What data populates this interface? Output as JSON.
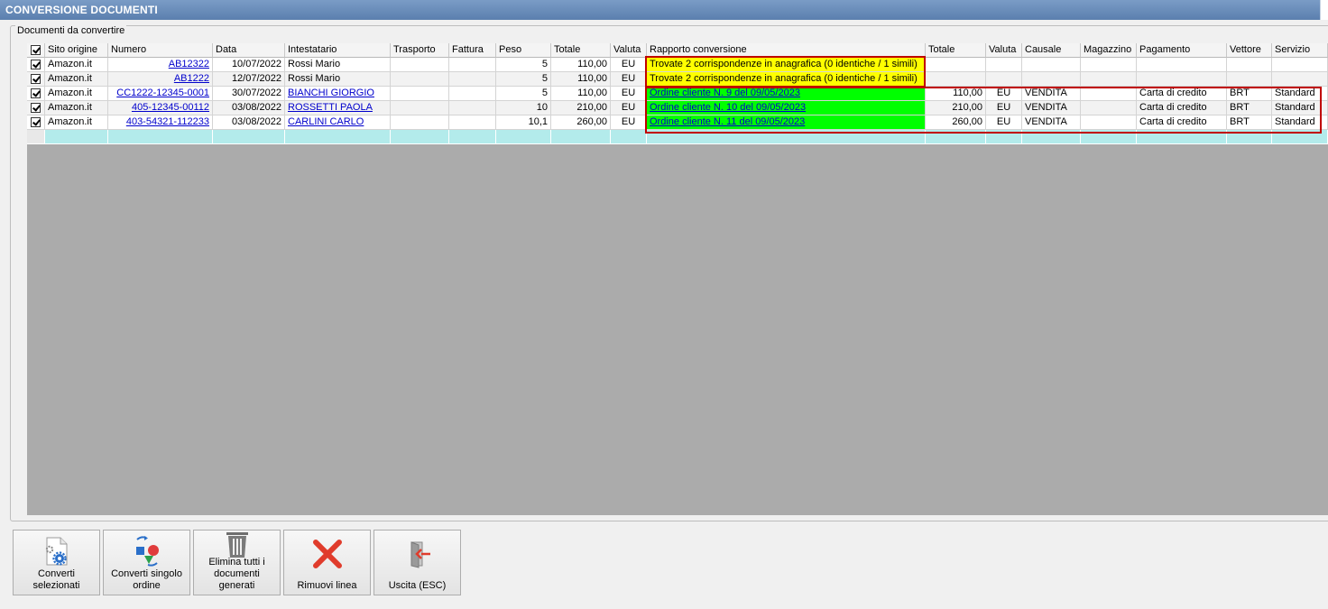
{
  "window": {
    "title": "CONVERSIONE DOCUMENTI"
  },
  "group": {
    "label": "Documenti da convertire"
  },
  "columns": [
    "",
    "Sito origine",
    "Numero",
    "Data",
    "Intestatario",
    "Trasporto",
    "Fattura",
    "Peso",
    "Totale",
    "Valuta",
    "Rapporto conversione",
    "Totale",
    "Valuta",
    "Causale",
    "Magazzino",
    "Pagamento",
    "Vettore",
    "Servizio"
  ],
  "rows": [
    {
      "checked": true,
      "sito": "Amazon.it",
      "numero": "AB12322",
      "data": "10/07/2022",
      "intestatario": "Rossi Mario",
      "trasporto": "",
      "fattura": "",
      "peso": "5",
      "totale": "110,00",
      "valuta": "EU",
      "rapporto": "Trovate 2 corrispondenze in anagrafica (0 identiche / 1 simili)",
      "totale2": "",
      "valuta2": "",
      "causale": "",
      "magazzino": "",
      "pagamento": "",
      "vettore": "",
      "servizio": ""
    },
    {
      "checked": true,
      "sito": "Amazon.it",
      "numero": "AB1222",
      "data": "12/07/2022",
      "intestatario": "Rossi Mario",
      "trasporto": "",
      "fattura": "",
      "peso": "5",
      "totale": "110,00",
      "valuta": "EU",
      "rapporto": "Trovate 2 corrispondenze in anagrafica (0 identiche / 1 simili)",
      "totale2": "",
      "valuta2": "",
      "causale": "",
      "magazzino": "",
      "pagamento": "",
      "vettore": "",
      "servizio": ""
    },
    {
      "checked": true,
      "sito": "Amazon.it",
      "numero": "CC1222-12345-0001",
      "data": "30/07/2022",
      "intestatario": "BIANCHI GIORGIO",
      "trasporto": "",
      "fattura": "",
      "peso": "5",
      "totale": "110,00",
      "valuta": "EU",
      "rapporto": "Ordine cliente N. 9 del 09/05/2023",
      "totale2": "110,00",
      "valuta2": "EU",
      "causale": "VENDITA",
      "magazzino": "",
      "pagamento": "Carta di credito",
      "vettore": "BRT",
      "servizio": "Standard"
    },
    {
      "checked": true,
      "sito": "Amazon.it",
      "numero": "405-12345-00112",
      "data": "03/08/2022",
      "intestatario": "ROSSETTI PAOLA",
      "trasporto": "",
      "fattura": "",
      "peso": "10",
      "totale": "210,00",
      "valuta": "EU",
      "rapporto": "Ordine cliente N. 10 del 09/05/2023",
      "totale2": "210,00",
      "valuta2": "EU",
      "causale": "VENDITA",
      "magazzino": "",
      "pagamento": "Carta di credito",
      "vettore": "BRT",
      "servizio": "Standard"
    },
    {
      "checked": true,
      "sito": "Amazon.it",
      "numero": "403-54321-112233",
      "data": "03/08/2022",
      "intestatario": "CARLINI CARLO",
      "trasporto": "",
      "fattura": "",
      "peso": "10,1",
      "totale": "260,00",
      "valuta": "EU",
      "rapporto": "Ordine cliente N. 11 del 09/05/2023",
      "totale2": "260,00",
      "valuta2": "EU",
      "causale": "VENDITA",
      "magazzino": "",
      "pagamento": "Carta di credito",
      "vettore": "BRT",
      "servizio": "Standard"
    }
  ],
  "buttons": {
    "converti_selezionati": "Converti selezionati",
    "converti_singolo": "Converti singolo ordine",
    "elimina_tutti": "Elimina tutti i documenti generati",
    "rimuovi_linea": "Rimuovi linea",
    "uscita": "Uscita (ESC)"
  },
  "colors": {
    "warning": "#ffff00",
    "success": "#00ff00",
    "new_row": "#b3ebeb",
    "highlight": "#c00000"
  }
}
